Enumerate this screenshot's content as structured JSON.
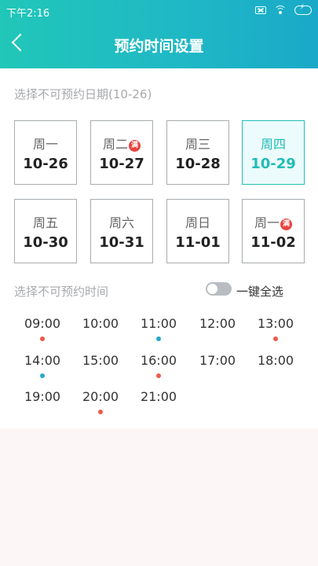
{
  "status": {
    "time": "下午2:16"
  },
  "header": {
    "title": "预约时间设置"
  },
  "date_section": {
    "label": "选择不可预约日期(10-26)"
  },
  "days": [
    {
      "week": "周一",
      "date": "10-26",
      "full": false,
      "selected": false
    },
    {
      "week": "周二",
      "date": "10-27",
      "full": true,
      "selected": false
    },
    {
      "week": "周三",
      "date": "10-28",
      "full": false,
      "selected": false
    },
    {
      "week": "周四",
      "date": "10-29",
      "full": false,
      "selected": true
    },
    {
      "week": "周五",
      "date": "10-30",
      "full": false,
      "selected": false
    },
    {
      "week": "周六",
      "date": "10-31",
      "full": false,
      "selected": false
    },
    {
      "week": "周日",
      "date": "11-01",
      "full": false,
      "selected": false
    },
    {
      "week": "周一",
      "date": "11-02",
      "full": true,
      "selected": false
    }
  ],
  "full_badge_text": "满",
  "time_section": {
    "label": "选择不可预约时间",
    "select_all_label": "一键全选",
    "select_all_on": false
  },
  "times": [
    {
      "time": "09:00",
      "dot": "red"
    },
    {
      "time": "10:00",
      "dot": ""
    },
    {
      "time": "11:00",
      "dot": "blue"
    },
    {
      "time": "12:00",
      "dot": ""
    },
    {
      "time": "13:00",
      "dot": "red"
    },
    {
      "time": "14:00",
      "dot": "blue"
    },
    {
      "time": "15:00",
      "dot": ""
    },
    {
      "time": "16:00",
      "dot": "red"
    },
    {
      "time": "17:00",
      "dot": ""
    },
    {
      "time": "18:00",
      "dot": ""
    },
    {
      "time": "19:00",
      "dot": ""
    },
    {
      "time": "20:00",
      "dot": "red"
    },
    {
      "time": "21:00",
      "dot": ""
    }
  ],
  "colors": {
    "accent": "#21bfb9",
    "badge_red": "#e7433f",
    "dot_red": "#ec5a4b",
    "dot_blue": "#24a9c9"
  }
}
